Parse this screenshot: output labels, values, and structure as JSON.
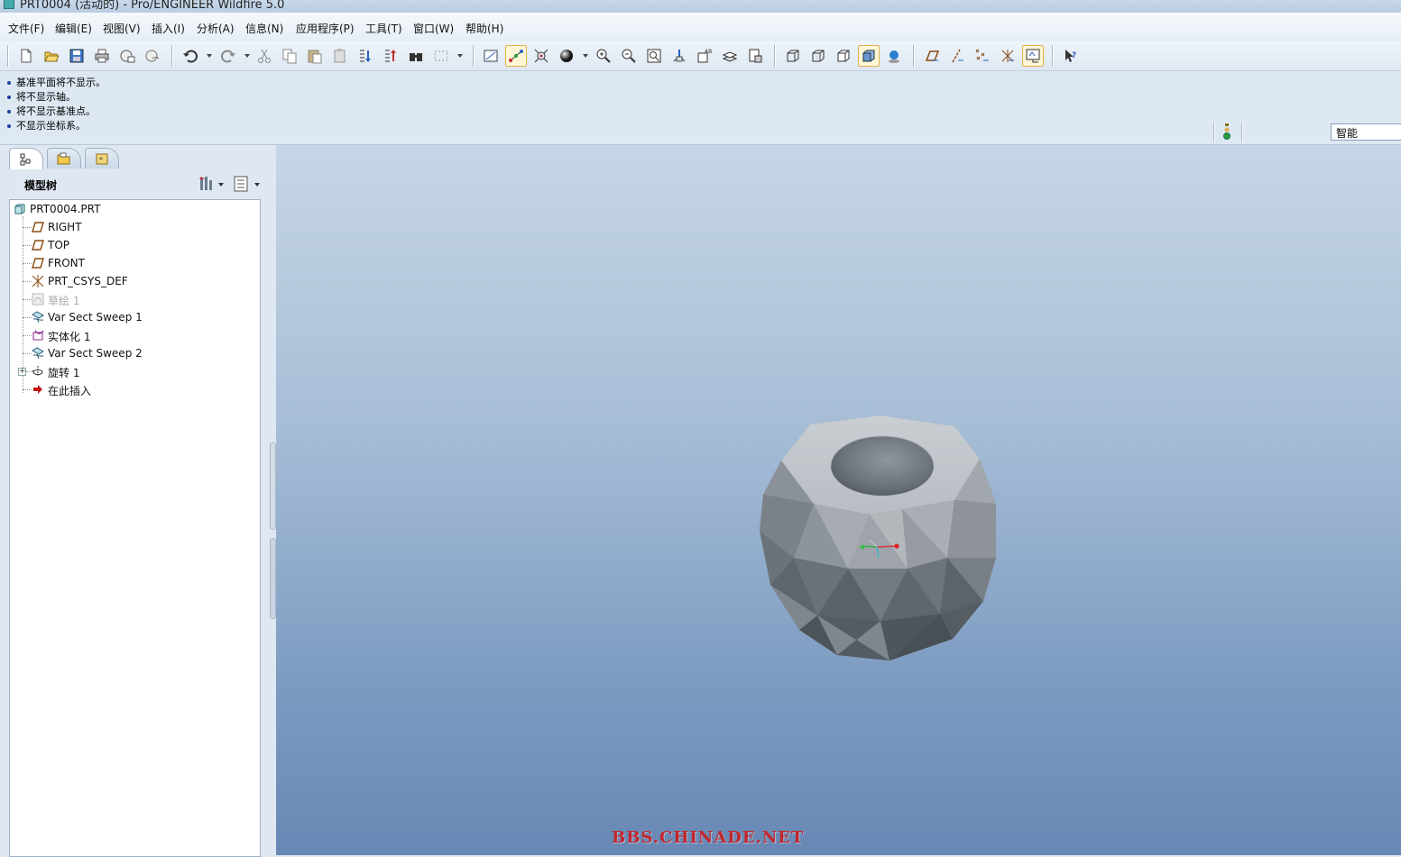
{
  "window": {
    "title": "PRT0004 (活动的) - Pro/ENGINEER Wildfire 5.0"
  },
  "menubar": {
    "items": [
      "文件(F)",
      "编辑(E)",
      "视图(V)",
      "插入(I)",
      "分析(A)",
      "信息(N)",
      "应用程序(P)",
      "工具(T)",
      "窗口(W)",
      "帮助(H)"
    ]
  },
  "toolbar": {
    "icons": [
      "new-icon",
      "open-icon",
      "save-icon",
      "print-icon",
      "send-mail-icon",
      "send-link-icon",
      "undo-icon",
      "redo-icon",
      "cut-icon",
      "copy-icon",
      "paste-icon",
      "paste-special-icon",
      "regenerate-icon",
      "regen-manager-icon",
      "find-icon",
      "select-box-icon",
      "datum-display-icon",
      "spin-center-icon",
      "orient-mode-icon",
      "appearance-ball-icon",
      "zoom-in-icon",
      "zoom-out-icon",
      "refit-icon",
      "reorient-icon",
      "saved-views-icon",
      "layers-icon",
      "view-manager-icon",
      "wireframe-icon",
      "hidden-line-icon",
      "no-hidden-icon",
      "shading-icon",
      "enhanced-realism-icon",
      "datum-planes-icon",
      "datum-axes-icon",
      "datum-points-icon",
      "coord-systems-icon",
      "annotation-icon",
      "whats-this-icon"
    ],
    "active": [
      "spin-center-icon",
      "shading-icon",
      "annotation-icon"
    ]
  },
  "messages": [
    "基准平面将不显示。",
    "将不显示轴。",
    "将不显示基准点。",
    "不显示坐标系。"
  ],
  "selection_filter": {
    "value": "智能"
  },
  "model_tree": {
    "title": "模型树",
    "items": [
      {
        "label": "PRT0004.PRT",
        "icon": "part-icon",
        "level": 0
      },
      {
        "label": "RIGHT",
        "icon": "datum-plane-icon",
        "level": 1
      },
      {
        "label": "TOP",
        "icon": "datum-plane-icon",
        "level": 1
      },
      {
        "label": "FRONT",
        "icon": "datum-plane-icon",
        "level": 1
      },
      {
        "label": "PRT_CSYS_DEF",
        "icon": "csys-icon",
        "level": 1
      },
      {
        "label": "草绘 1",
        "icon": "sketch-icon",
        "level": 1,
        "suppressed": true
      },
      {
        "label": "Var Sect Sweep 1",
        "icon": "sweep-icon",
        "level": 1
      },
      {
        "label": "实体化 1",
        "icon": "solidify-icon",
        "level": 1
      },
      {
        "label": "Var Sect Sweep 2",
        "icon": "sweep-icon",
        "level": 1
      },
      {
        "label": "旋转 1",
        "icon": "revolve-icon",
        "level": 1,
        "expandable": true
      },
      {
        "label": "在此插入",
        "icon": "insert-here-arrow-icon",
        "level": 1
      }
    ]
  },
  "watermark": "BBS.CHINADE.NET",
  "colors": {
    "accent_active": "#fff7d6",
    "watermark": "#c1272d",
    "viewport_top": "#c7d6e6",
    "viewport_bottom": "#6887b4"
  }
}
